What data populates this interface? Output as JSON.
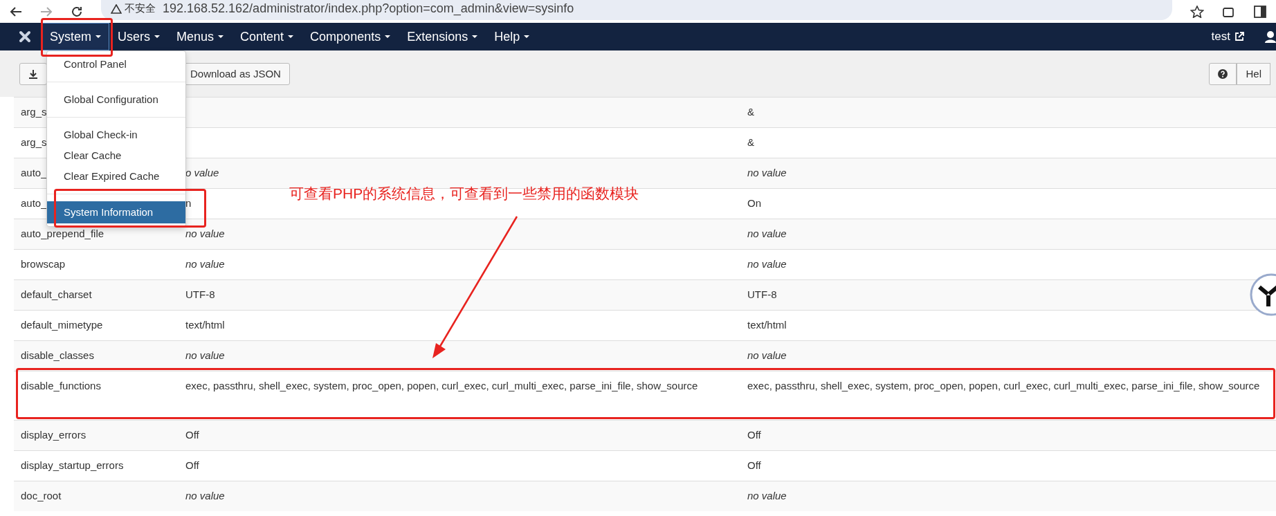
{
  "browser": {
    "security": "不安全",
    "url": "192.168.52.162/administrator/index.php?option=com_admin&view=sysinfo"
  },
  "nav": {
    "items": [
      {
        "label": "System",
        "selected": true
      },
      {
        "label": "Users",
        "selected": false
      },
      {
        "label": "Menus",
        "selected": false
      },
      {
        "label": "Content",
        "selected": false
      },
      {
        "label": "Components",
        "selected": false
      },
      {
        "label": "Extensions",
        "selected": false
      },
      {
        "label": "Help",
        "selected": false
      }
    ],
    "user": "test"
  },
  "toolbar": {
    "download_json": "Download as JSON",
    "help": "Hel"
  },
  "menu": {
    "groups": [
      [
        {
          "label": "Control Panel",
          "selected": false
        }
      ],
      [
        {
          "label": "Global Configuration",
          "selected": false
        }
      ],
      [
        {
          "label": "Global Check-in",
          "selected": false
        },
        {
          "label": "Clear Cache",
          "selected": false
        },
        {
          "label": "Clear Expired Cache",
          "selected": false
        }
      ],
      [
        {
          "label": "System Information",
          "selected": true
        }
      ]
    ]
  },
  "table": {
    "rows": [
      {
        "name": "arg_s",
        "master": "&",
        "empty": false
      },
      {
        "name": "arg_s",
        "master": "&",
        "empty": false
      },
      {
        "name": "auto_",
        "local": "o value",
        "master": "no value",
        "empty": true
      },
      {
        "name": "auto_",
        "local": "n",
        "master": "On",
        "empty": false
      },
      {
        "name": "auto_prepend_file",
        "local": "no value",
        "master": "no value",
        "empty": true
      },
      {
        "name": "browscap",
        "local": "no value",
        "master": "no value",
        "empty": true
      },
      {
        "name": "default_charset",
        "local": "UTF-8",
        "master": "UTF-8",
        "empty": false
      },
      {
        "name": "default_mimetype",
        "local": "text/html",
        "master": "text/html",
        "empty": false
      },
      {
        "name": "disable_classes",
        "local": "no value",
        "master": "no value",
        "empty": true
      },
      {
        "name": "disable_functions",
        "local": "exec, passthru, shell_exec, system, proc_open, popen, curl_exec, curl_multi_exec, parse_ini_file, show_source",
        "master": "exec, passthru, shell_exec, system, proc_open, popen, curl_exec, curl_multi_exec, parse_ini_file, show_source",
        "empty": false
      },
      {
        "name": "display_errors",
        "local": "Off",
        "master": "Off",
        "empty": false
      },
      {
        "name": "display_startup_errors",
        "local": "Off",
        "master": "Off",
        "empty": false
      },
      {
        "name": "doc_root",
        "local": "no value",
        "master": "no value",
        "empty": true
      }
    ]
  },
  "annotation": {
    "text": "可查看PHP的系统信息，可查看到一些禁用的函数模块"
  }
}
